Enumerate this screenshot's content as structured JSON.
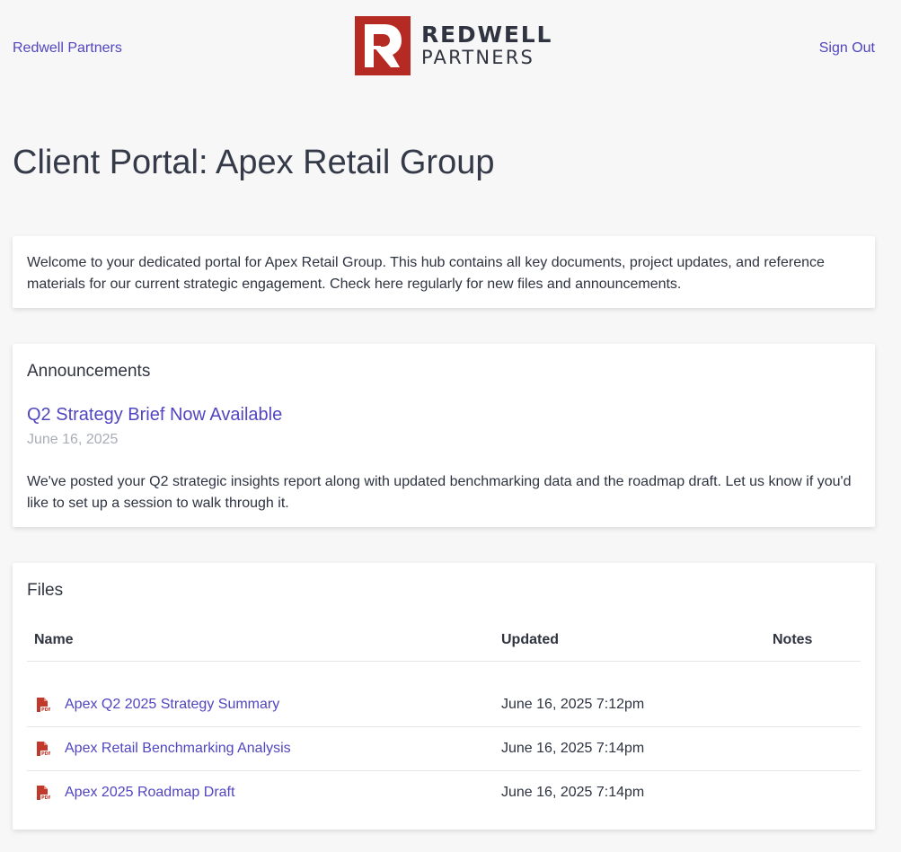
{
  "nav": {
    "left_link": "Redwell Partners",
    "right_link": "Sign Out"
  },
  "logo": {
    "line1": "REDWELL",
    "line2": "PARTNERS",
    "color": "#b52a22"
  },
  "page": {
    "title": "Client Portal: Apex Retail Group"
  },
  "welcome": {
    "text": "Welcome to your dedicated portal for Apex Retail Group. This hub contains all key documents, project updates, and reference materials for our current strategic engagement. Check here regularly for new files and announcements."
  },
  "announcements": {
    "heading": "Announcements",
    "title": "Q2 Strategy Brief Now Available",
    "date": "June 16, 2025",
    "body": "We've posted your Q2 strategic insights report along with updated benchmarking data and the roadmap draft. Let us know if you'd like to set up a session to walk through it."
  },
  "files": {
    "heading": "Files",
    "columns": {
      "name": "Name",
      "updated": "Updated",
      "notes": "Notes"
    },
    "rows": [
      {
        "icon": "pdf-icon",
        "name": "Apex Q2 2025 Strategy Summary",
        "updated": "June 16, 2025 7:12pm",
        "notes": ""
      },
      {
        "icon": "pdf-icon",
        "name": "Apex Retail Benchmarking Analysis",
        "updated": "June 16, 2025 7:14pm",
        "notes": ""
      },
      {
        "icon": "pdf-icon",
        "name": "Apex 2025 Roadmap Draft",
        "updated": "June 16, 2025 7:14pm",
        "notes": ""
      }
    ]
  },
  "colors": {
    "link": "#5046c0",
    "text": "#2d3340",
    "muted": "#a8adb6",
    "pdf": "#c0392b"
  }
}
